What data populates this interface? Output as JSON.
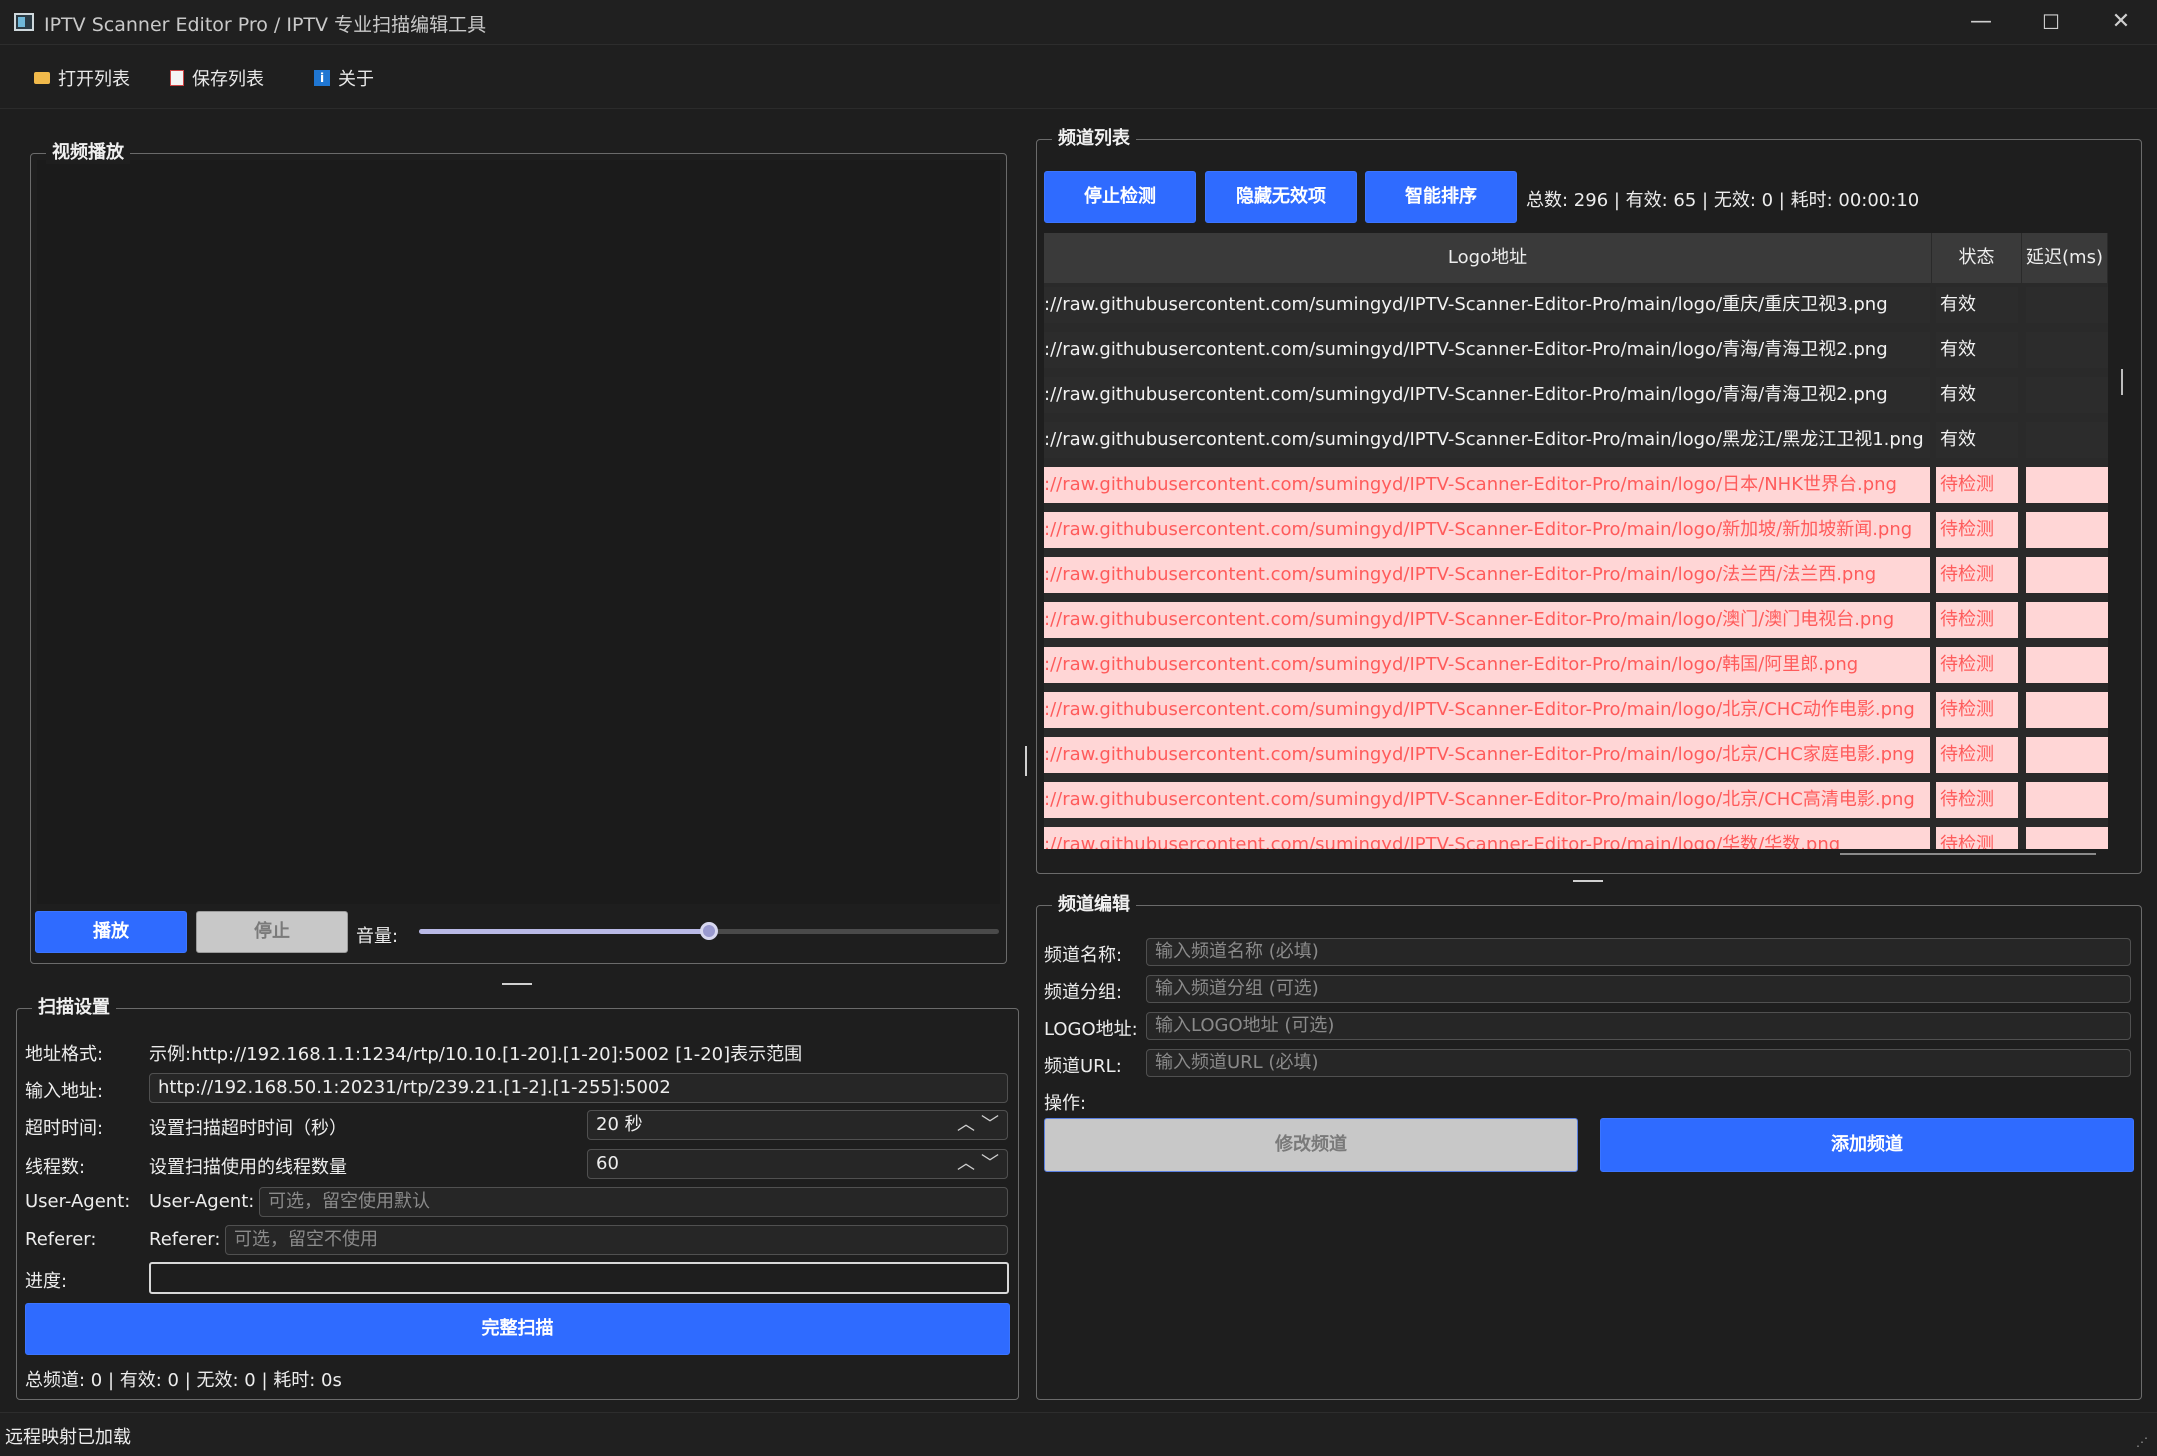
{
  "window": {
    "title": "IPTV Scanner Editor Pro / IPTV 专业扫描编辑工具",
    "min": "—",
    "max": "☐",
    "close": "✕"
  },
  "menu": {
    "open": "打开列表",
    "save": "保存列表",
    "about": "关于"
  },
  "video": {
    "group_title": "视频播放",
    "play": "播放",
    "stop": "停止",
    "volume_label": "音量:",
    "volume_level": 0.5
  },
  "scan": {
    "group_title": "扫描设置",
    "addr_format_label": "地址格式:",
    "addr_format_example": "示例:http://192.168.1.1:1234/rtp/10.10.[1-20].[1-20]:5002   [1-20]表示范围",
    "input_label": "输入地址:",
    "input_value": "http://192.168.50.1:20231/rtp/239.21.[1-2].[1-255]:5002",
    "timeout_label": "超时时间:",
    "timeout_desc": "设置扫描超时时间（秒）",
    "timeout_value": "20 秒",
    "threads_label": "线程数:",
    "threads_desc": "设置扫描使用的线程数量",
    "threads_value": "60",
    "ua_label": "User-Agent:",
    "ua_inner_label": "User-Agent:",
    "ua_placeholder": "可选，留空使用默认",
    "referer_label": "Referer:",
    "referer_inner_label": "Referer:",
    "referer_placeholder": "可选，留空不使用",
    "progress_label": "进度:",
    "progress_value": 0,
    "full_scan": "完整扫描",
    "summary": "总频道: 0 | 有效: 0 | 无效: 0 | 耗时: 0s"
  },
  "channels": {
    "group_title": "频道列表",
    "stop_check": "停止检测",
    "hide_invalid": "隐藏无效项",
    "smart_sort": "智能排序",
    "stats": "总数: 296 | 有效: 65 | 无效: 0 | 耗时: 00:00:10",
    "headers": [
      "Logo地址",
      "状态",
      "延迟(ms)"
    ],
    "rows": [
      {
        "url": "://raw.githubusercontent.com/sumingyd/IPTV-Scanner-Editor-Pro/main/logo/重庆/重庆卫视3.png",
        "status": "有效",
        "latency": "",
        "kind": "ok"
      },
      {
        "url": "://raw.githubusercontent.com/sumingyd/IPTV-Scanner-Editor-Pro/main/logo/青海/青海卫视2.png",
        "status": "有效",
        "latency": "",
        "kind": "ok"
      },
      {
        "url": "://raw.githubusercontent.com/sumingyd/IPTV-Scanner-Editor-Pro/main/logo/青海/青海卫视2.png",
        "status": "有效",
        "latency": "",
        "kind": "ok"
      },
      {
        "url": "://raw.githubusercontent.com/sumingyd/IPTV-Scanner-Editor-Pro/main/logo/黑龙江/黑龙江卫视1.png",
        "status": "有效",
        "latency": "",
        "kind": "ok"
      },
      {
        "url": "://raw.githubusercontent.com/sumingyd/IPTV-Scanner-Editor-Pro/main/logo/日本/NHK世界台.png",
        "status": "待检测",
        "latency": "",
        "kind": "pending"
      },
      {
        "url": "://raw.githubusercontent.com/sumingyd/IPTV-Scanner-Editor-Pro/main/logo/新加坡/新加坡新闻.png",
        "status": "待检测",
        "latency": "",
        "kind": "pending"
      },
      {
        "url": "://raw.githubusercontent.com/sumingyd/IPTV-Scanner-Editor-Pro/main/logo/法兰西/法兰西.png",
        "status": "待检测",
        "latency": "",
        "kind": "pending"
      },
      {
        "url": "://raw.githubusercontent.com/sumingyd/IPTV-Scanner-Editor-Pro/main/logo/澳门/澳门电视台.png",
        "status": "待检测",
        "latency": "",
        "kind": "pending"
      },
      {
        "url": "://raw.githubusercontent.com/sumingyd/IPTV-Scanner-Editor-Pro/main/logo/韩国/阿里郎.png",
        "status": "待检测",
        "latency": "",
        "kind": "pending"
      },
      {
        "url": "://raw.githubusercontent.com/sumingyd/IPTV-Scanner-Editor-Pro/main/logo/北京/CHC动作电影.png",
        "status": "待检测",
        "latency": "",
        "kind": "pending"
      },
      {
        "url": "://raw.githubusercontent.com/sumingyd/IPTV-Scanner-Editor-Pro/main/logo/北京/CHC家庭电影.png",
        "status": "待检测",
        "latency": "",
        "kind": "pending"
      },
      {
        "url": "://raw.githubusercontent.com/sumingyd/IPTV-Scanner-Editor-Pro/main/logo/北京/CHC高清电影.png",
        "status": "待检测",
        "latency": "",
        "kind": "pending"
      },
      {
        "url": "://raw.githubusercontent.com/sumingyd/IPTV-Scanner-Editor-Pro/main/logo/华数/华数.png",
        "status": "待检测",
        "latency": "",
        "kind": "pending"
      }
    ]
  },
  "edit": {
    "group_title": "频道编辑",
    "name_label": "频道名称:",
    "name_placeholder": "输入频道名称 (必填)",
    "group_label": "频道分组:",
    "group_placeholder": "输入频道分组 (可选)",
    "logo_label": "LOGO地址:",
    "logo_placeholder": "输入LOGO地址 (可选)",
    "url_label": "频道URL:",
    "url_placeholder": "输入频道URL (必填)",
    "ops_label": "操作:",
    "modify": "修改频道",
    "add": "添加频道"
  },
  "status_bar": "远程映射已加载",
  "colors": {
    "accent": "#2f6bff",
    "pending_bg": "#ffd6d6",
    "pending_text": "#ff5b5b",
    "background": "#1e1e1e"
  }
}
